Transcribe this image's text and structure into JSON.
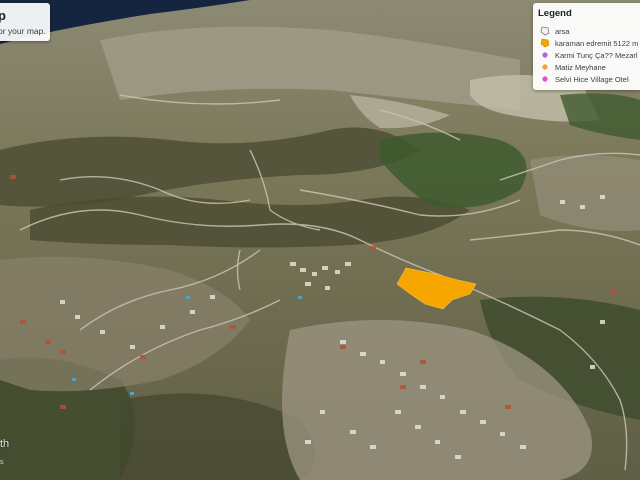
{
  "title_card": {
    "title": "p",
    "subtitle": "or your map."
  },
  "legend": {
    "heading": "Legend",
    "items": [
      {
        "label": "arsa",
        "icon": "polygon-outline-icon",
        "color": "#f2f2f2"
      },
      {
        "label": "karaman edremit 5122 m",
        "icon": "orange-polygon-icon",
        "color": "#f7a600"
      },
      {
        "label": "Karmi Tunç Ça?? Mezarl",
        "icon": "purple-pin-icon",
        "color": "#b266d6"
      },
      {
        "label": "Matiz Meyhane",
        "icon": "orange-pin-icon",
        "color": "#f5a142"
      },
      {
        "label": "Selvi Hice Village Otel",
        "icon": "pink-pin-icon",
        "color": "#e54fd8"
      }
    ]
  },
  "parcel": {
    "label": "karaman edremit 5122 m",
    "color": "#f7a600"
  },
  "watermark": {
    "text": "th",
    "sub": "s"
  }
}
